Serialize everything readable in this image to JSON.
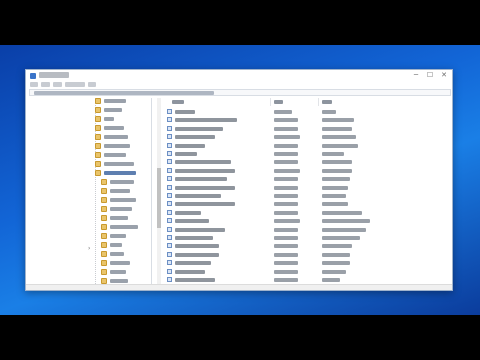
{
  "window": {
    "title": "",
    "icons": {
      "app": "registry-editor-icon",
      "minimize": "minimize-icon",
      "maximize": "maximize-icon",
      "close": "close-icon"
    },
    "minimize_glyph": "─",
    "maximize_glyph": "☐",
    "close_glyph": "✕"
  },
  "menu": {
    "items": [
      "",
      "",
      "",
      "",
      ""
    ]
  },
  "address": {
    "path": ""
  },
  "tree": {
    "items": [
      "",
      "",
      "",
      "",
      "",
      "",
      "",
      "",
      "",
      "",
      "",
      "",
      "",
      "",
      "",
      "",
      "",
      "",
      "",
      "",
      "",
      "",
      "",
      "",
      ""
    ],
    "selected_index": 8,
    "expand_glyph": "›"
  },
  "list": {
    "columns": [
      "",
      "",
      ""
    ],
    "rows": [
      {
        "name": "",
        "type": "",
        "data": ""
      },
      {
        "name": "",
        "type": "",
        "data": ""
      },
      {
        "name": "",
        "type": "",
        "data": ""
      },
      {
        "name": "",
        "type": "",
        "data": ""
      },
      {
        "name": "",
        "type": "",
        "data": ""
      },
      {
        "name": "",
        "type": "",
        "data": ""
      },
      {
        "name": "",
        "type": "",
        "data": ""
      },
      {
        "name": "",
        "type": "",
        "data": ""
      },
      {
        "name": "",
        "type": "",
        "data": ""
      },
      {
        "name": "",
        "type": "",
        "data": ""
      },
      {
        "name": "",
        "type": "",
        "data": ""
      },
      {
        "name": "",
        "type": "",
        "data": ""
      },
      {
        "name": "",
        "type": "",
        "data": ""
      },
      {
        "name": "",
        "type": "",
        "data": ""
      },
      {
        "name": "",
        "type": "",
        "data": ""
      },
      {
        "name": "",
        "type": "",
        "data": ""
      },
      {
        "name": "",
        "type": "",
        "data": ""
      },
      {
        "name": "",
        "type": "",
        "data": ""
      },
      {
        "name": "",
        "type": "",
        "data": ""
      },
      {
        "name": "",
        "type": "",
        "data": ""
      },
      {
        "name": "",
        "type": "",
        "data": ""
      }
    ]
  },
  "colors": {
    "desktop_accent": "#1265d6",
    "folder": "#e9c46a",
    "selection": "#5e7fb0"
  }
}
